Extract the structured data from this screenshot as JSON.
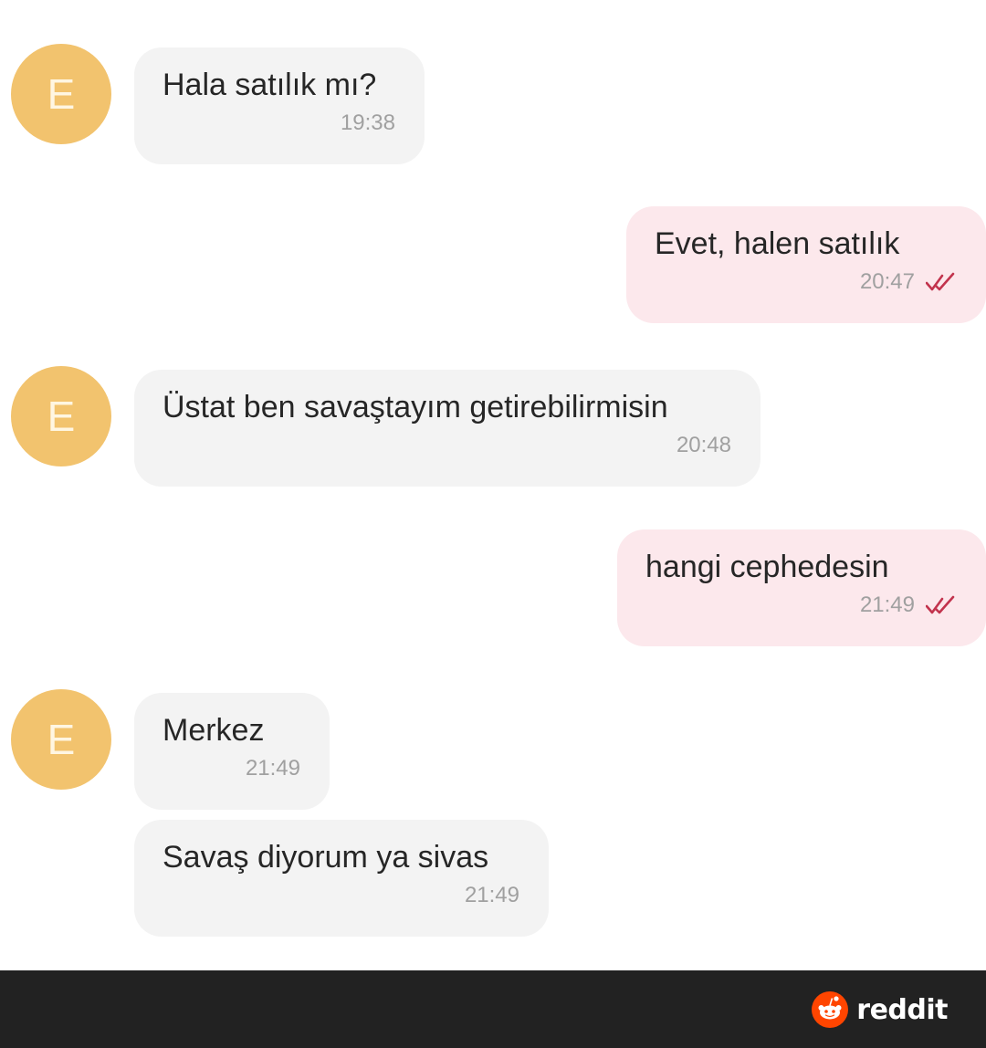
{
  "avatar_letter": "E",
  "messages": [
    {
      "direction": "incoming",
      "text": "Hala satılık mı?",
      "time": "19:38"
    },
    {
      "direction": "outgoing",
      "text": "Evet, halen satılık",
      "time": "20:47",
      "status_icon": "double-check-icon"
    },
    {
      "direction": "incoming",
      "text": "Üstat ben savaştayım getirebilirmisin",
      "time": "20:48"
    },
    {
      "direction": "outgoing",
      "text": "hangi cephedesin",
      "time": "21:49",
      "status_icon": "double-check-icon"
    },
    {
      "direction": "incoming",
      "text": "Merkez",
      "time": "21:49"
    },
    {
      "direction": "incoming",
      "text": "Savaş diyorum ya sivas",
      "time": "21:49"
    }
  ],
  "footer": {
    "brand_text": "reddit",
    "brand_icon": "reddit-logo-icon"
  },
  "colors": {
    "avatar": "#f2c36e",
    "incoming_bubble": "#f3f3f3",
    "outgoing_bubble": "#fce8ec",
    "read_check": "#c2334d",
    "footer_bar": "#222222",
    "reddit_orange": "#ff4500"
  }
}
